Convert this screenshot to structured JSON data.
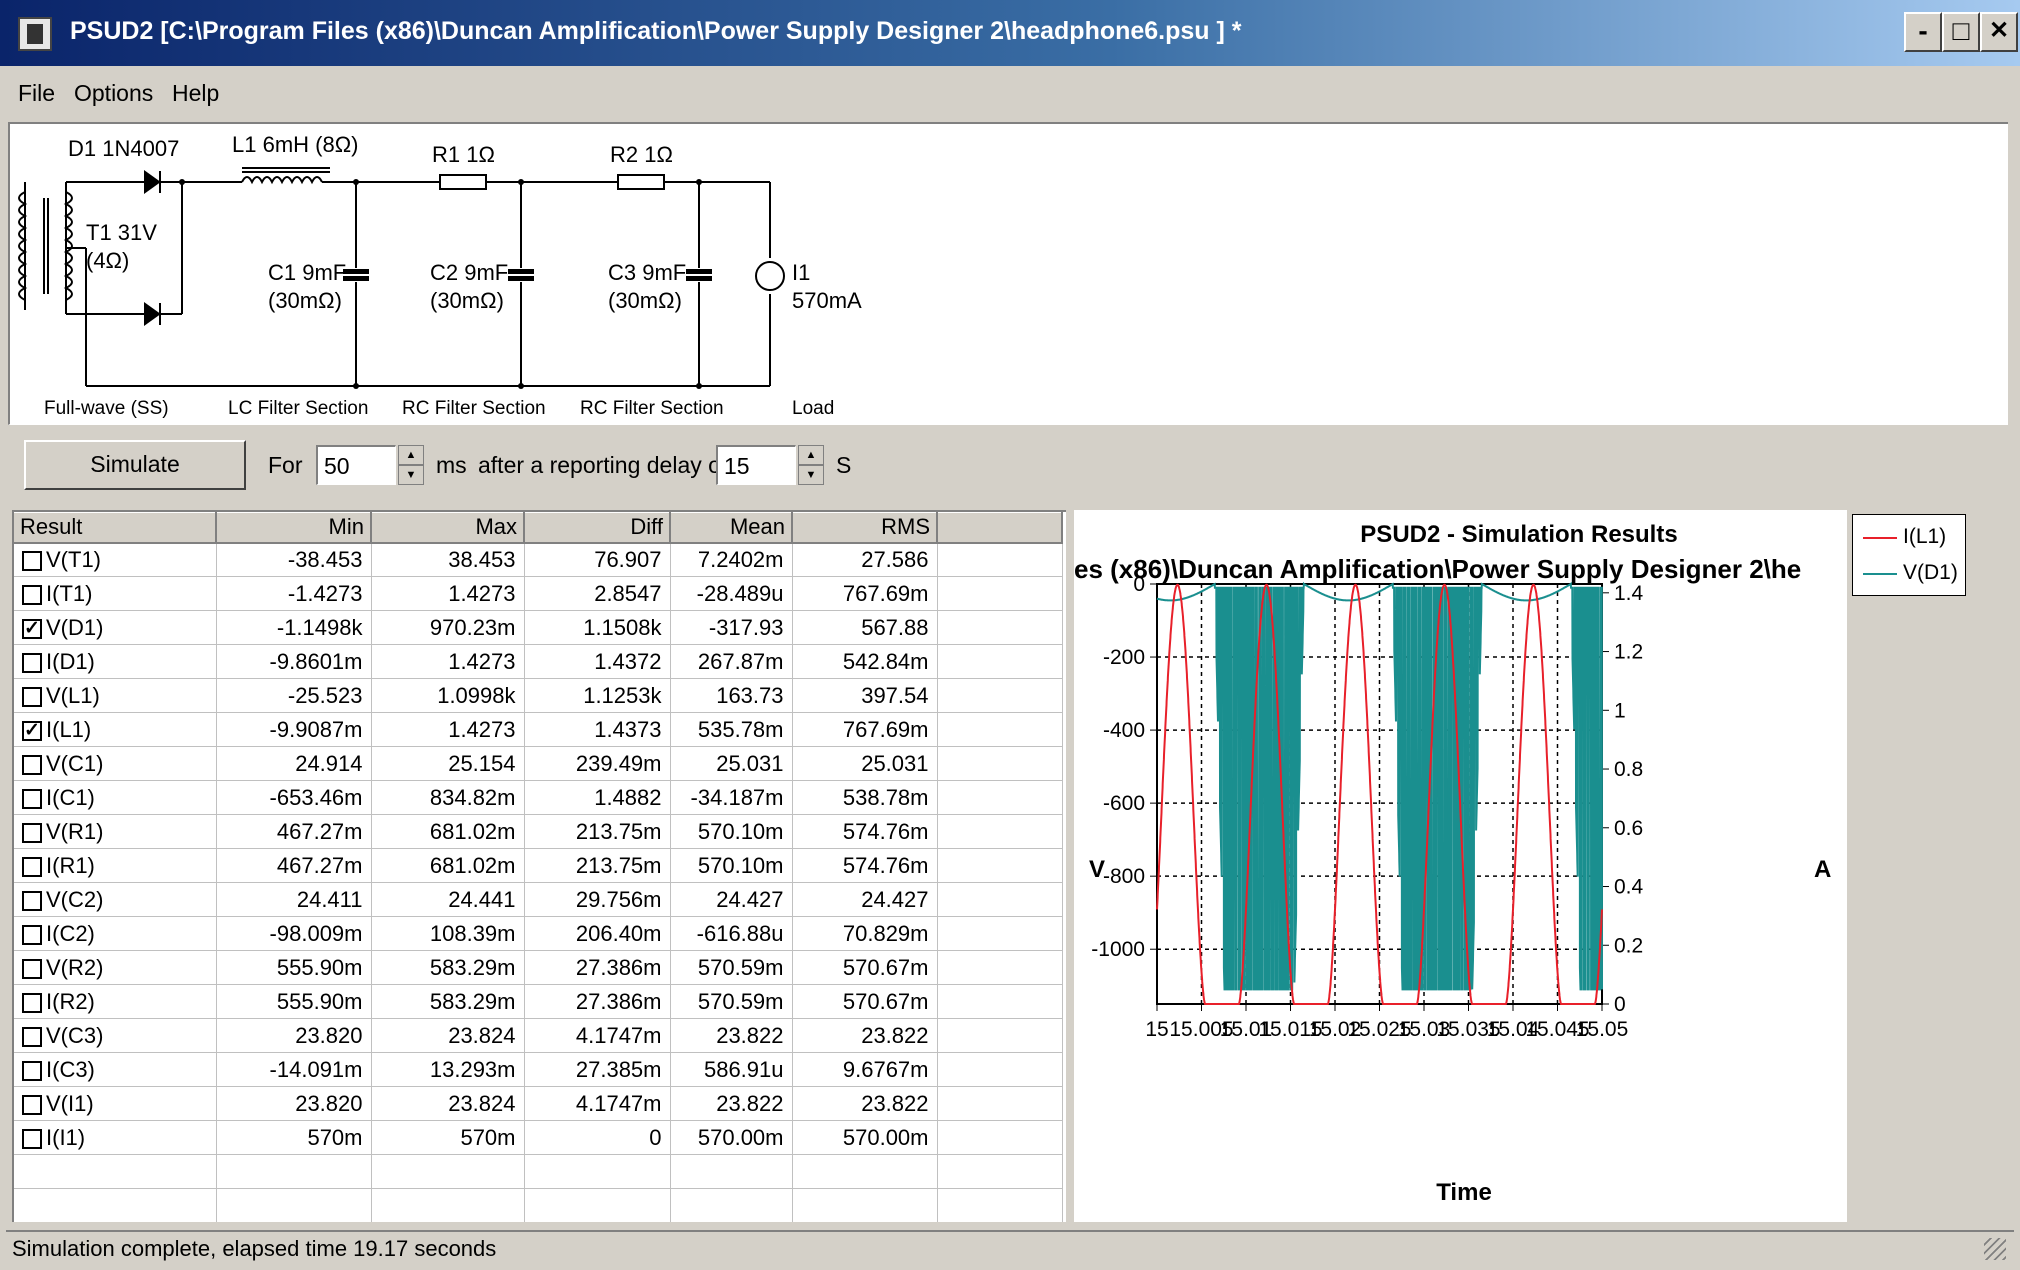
{
  "window": {
    "title": "PSUD2  [C:\\Program Files (x86)\\Duncan Amplification\\Power Supply Designer 2\\headphone6.psu ] *",
    "minimize": "-",
    "maximize": "□",
    "close": "✕"
  },
  "menu": [
    "File",
    "Options",
    "Help"
  ],
  "schematic": {
    "d1": "D1 1N4007",
    "l1": "L1 6mH (8Ω)",
    "r1": "R1 1Ω",
    "r2": "R2 1Ω",
    "t1_a": "T1 31V",
    "t1_b": "(4Ω)",
    "c1_a": "C1 9mF",
    "c1_b": "(30mΩ)",
    "c2_a": "C2 9mF",
    "c2_b": "(30mΩ)",
    "c3_a": "C3 9mF",
    "c3_b": "(30mΩ)",
    "i1_a": "I1",
    "i1_b": "570mA",
    "sections": [
      "Full-wave (SS)",
      "LC Filter Section",
      "RC Filter Section",
      "RC Filter Section",
      "Load"
    ]
  },
  "controls": {
    "simulate": "Simulate",
    "for_label": "For",
    "duration": "50",
    "ms_label": "ms",
    "delay_label": "after a reporting delay of",
    "delay": "15",
    "s_label": "S"
  },
  "table": {
    "headers": [
      "Result",
      "Min",
      "Max",
      "Diff",
      "Mean",
      "RMS"
    ],
    "rows": [
      {
        "name": "V(T1)",
        "checked": false,
        "min": "-38.453",
        "max": "38.453",
        "diff": "76.907",
        "mean": "7.2402m",
        "rms": "27.586"
      },
      {
        "name": "I(T1)",
        "checked": false,
        "min": "-1.4273",
        "max": "1.4273",
        "diff": "2.8547",
        "mean": "-28.489u",
        "rms": "767.69m"
      },
      {
        "name": "V(D1)",
        "checked": true,
        "min": "-1.1498k",
        "max": "970.23m",
        "diff": "1.1508k",
        "mean": "-317.93",
        "rms": "567.88"
      },
      {
        "name": "I(D1)",
        "checked": false,
        "min": "-9.8601m",
        "max": "1.4273",
        "diff": "1.4372",
        "mean": "267.87m",
        "rms": "542.84m"
      },
      {
        "name": "V(L1)",
        "checked": false,
        "min": "-25.523",
        "max": "1.0998k",
        "diff": "1.1253k",
        "mean": "163.73",
        "rms": "397.54"
      },
      {
        "name": "I(L1)",
        "checked": true,
        "min": "-9.9087m",
        "max": "1.4273",
        "diff": "1.4373",
        "mean": "535.78m",
        "rms": "767.69m"
      },
      {
        "name": "V(C1)",
        "checked": false,
        "min": "24.914",
        "max": "25.154",
        "diff": "239.49m",
        "mean": "25.031",
        "rms": "25.031"
      },
      {
        "name": "I(C1)",
        "checked": false,
        "min": "-653.46m",
        "max": "834.82m",
        "diff": "1.4882",
        "mean": "-34.187m",
        "rms": "538.78m"
      },
      {
        "name": "V(R1)",
        "checked": false,
        "min": "467.27m",
        "max": "681.02m",
        "diff": "213.75m",
        "mean": "570.10m",
        "rms": "574.76m"
      },
      {
        "name": "I(R1)",
        "checked": false,
        "min": "467.27m",
        "max": "681.02m",
        "diff": "213.75m",
        "mean": "570.10m",
        "rms": "574.76m"
      },
      {
        "name": "V(C2)",
        "checked": false,
        "min": "24.411",
        "max": "24.441",
        "diff": "29.756m",
        "mean": "24.427",
        "rms": "24.427"
      },
      {
        "name": "I(C2)",
        "checked": false,
        "min": "-98.009m",
        "max": "108.39m",
        "diff": "206.40m",
        "mean": "-616.88u",
        "rms": "70.829m"
      },
      {
        "name": "V(R2)",
        "checked": false,
        "min": "555.90m",
        "max": "583.29m",
        "diff": "27.386m",
        "mean": "570.59m",
        "rms": "570.67m"
      },
      {
        "name": "I(R2)",
        "checked": false,
        "min": "555.90m",
        "max": "583.29m",
        "diff": "27.386m",
        "mean": "570.59m",
        "rms": "570.67m"
      },
      {
        "name": "V(C3)",
        "checked": false,
        "min": "23.820",
        "max": "23.824",
        "diff": "4.1747m",
        "mean": "23.822",
        "rms": "23.822"
      },
      {
        "name": "I(C3)",
        "checked": false,
        "min": "-14.091m",
        "max": "13.293m",
        "diff": "27.385m",
        "mean": "586.91u",
        "rms": "9.6767m"
      },
      {
        "name": "V(I1)",
        "checked": false,
        "min": "23.820",
        "max": "23.824",
        "diff": "4.1747m",
        "mean": "23.822",
        "rms": "23.822"
      },
      {
        "name": "I(I1)",
        "checked": false,
        "min": "570m",
        "max": "570m",
        "diff": "0",
        "mean": "570.00m",
        "rms": "570.00m"
      }
    ]
  },
  "chart_data": {
    "type": "line",
    "title": "PSUD2 - Simulation Results",
    "subtitle": "es (x86)\\Duncan Amplification\\Power Supply Designer 2\\he",
    "xlabel": "Time",
    "ylabel_left": "V",
    "ylabel_right": "A",
    "x_ticks": [
      "15",
      "15.005",
      "15.01",
      "15.015",
      "15.02",
      "15.025",
      "15.03",
      "15.035",
      "15.04",
      "15.045",
      "15.05"
    ],
    "xlim": [
      15,
      15.05
    ],
    "y_left_ticks": [
      "0",
      "-200",
      "-400",
      "-600",
      "-800",
      "-1000"
    ],
    "ylim_left": [
      -1150,
      0
    ],
    "y_right_ticks": [
      "1.4",
      "1.2",
      "1",
      "0.8",
      "0.6",
      "0.4",
      "0.2",
      "0"
    ],
    "ylim_right": [
      0,
      1.43
    ],
    "grid": true,
    "legend_position": "top-right",
    "series": [
      {
        "name": "I(L1)",
        "color": "#e8202a",
        "axis": "right",
        "description_values": {
          "peak": 1.4273,
          "min": 0.0
        }
      },
      {
        "name": "V(D1)",
        "color": "#1a8f8f",
        "axis": "left",
        "description_values": {
          "max": 0,
          "min": -1150
        }
      }
    ]
  },
  "status": "Simulation complete, elapsed time 19.17 seconds"
}
